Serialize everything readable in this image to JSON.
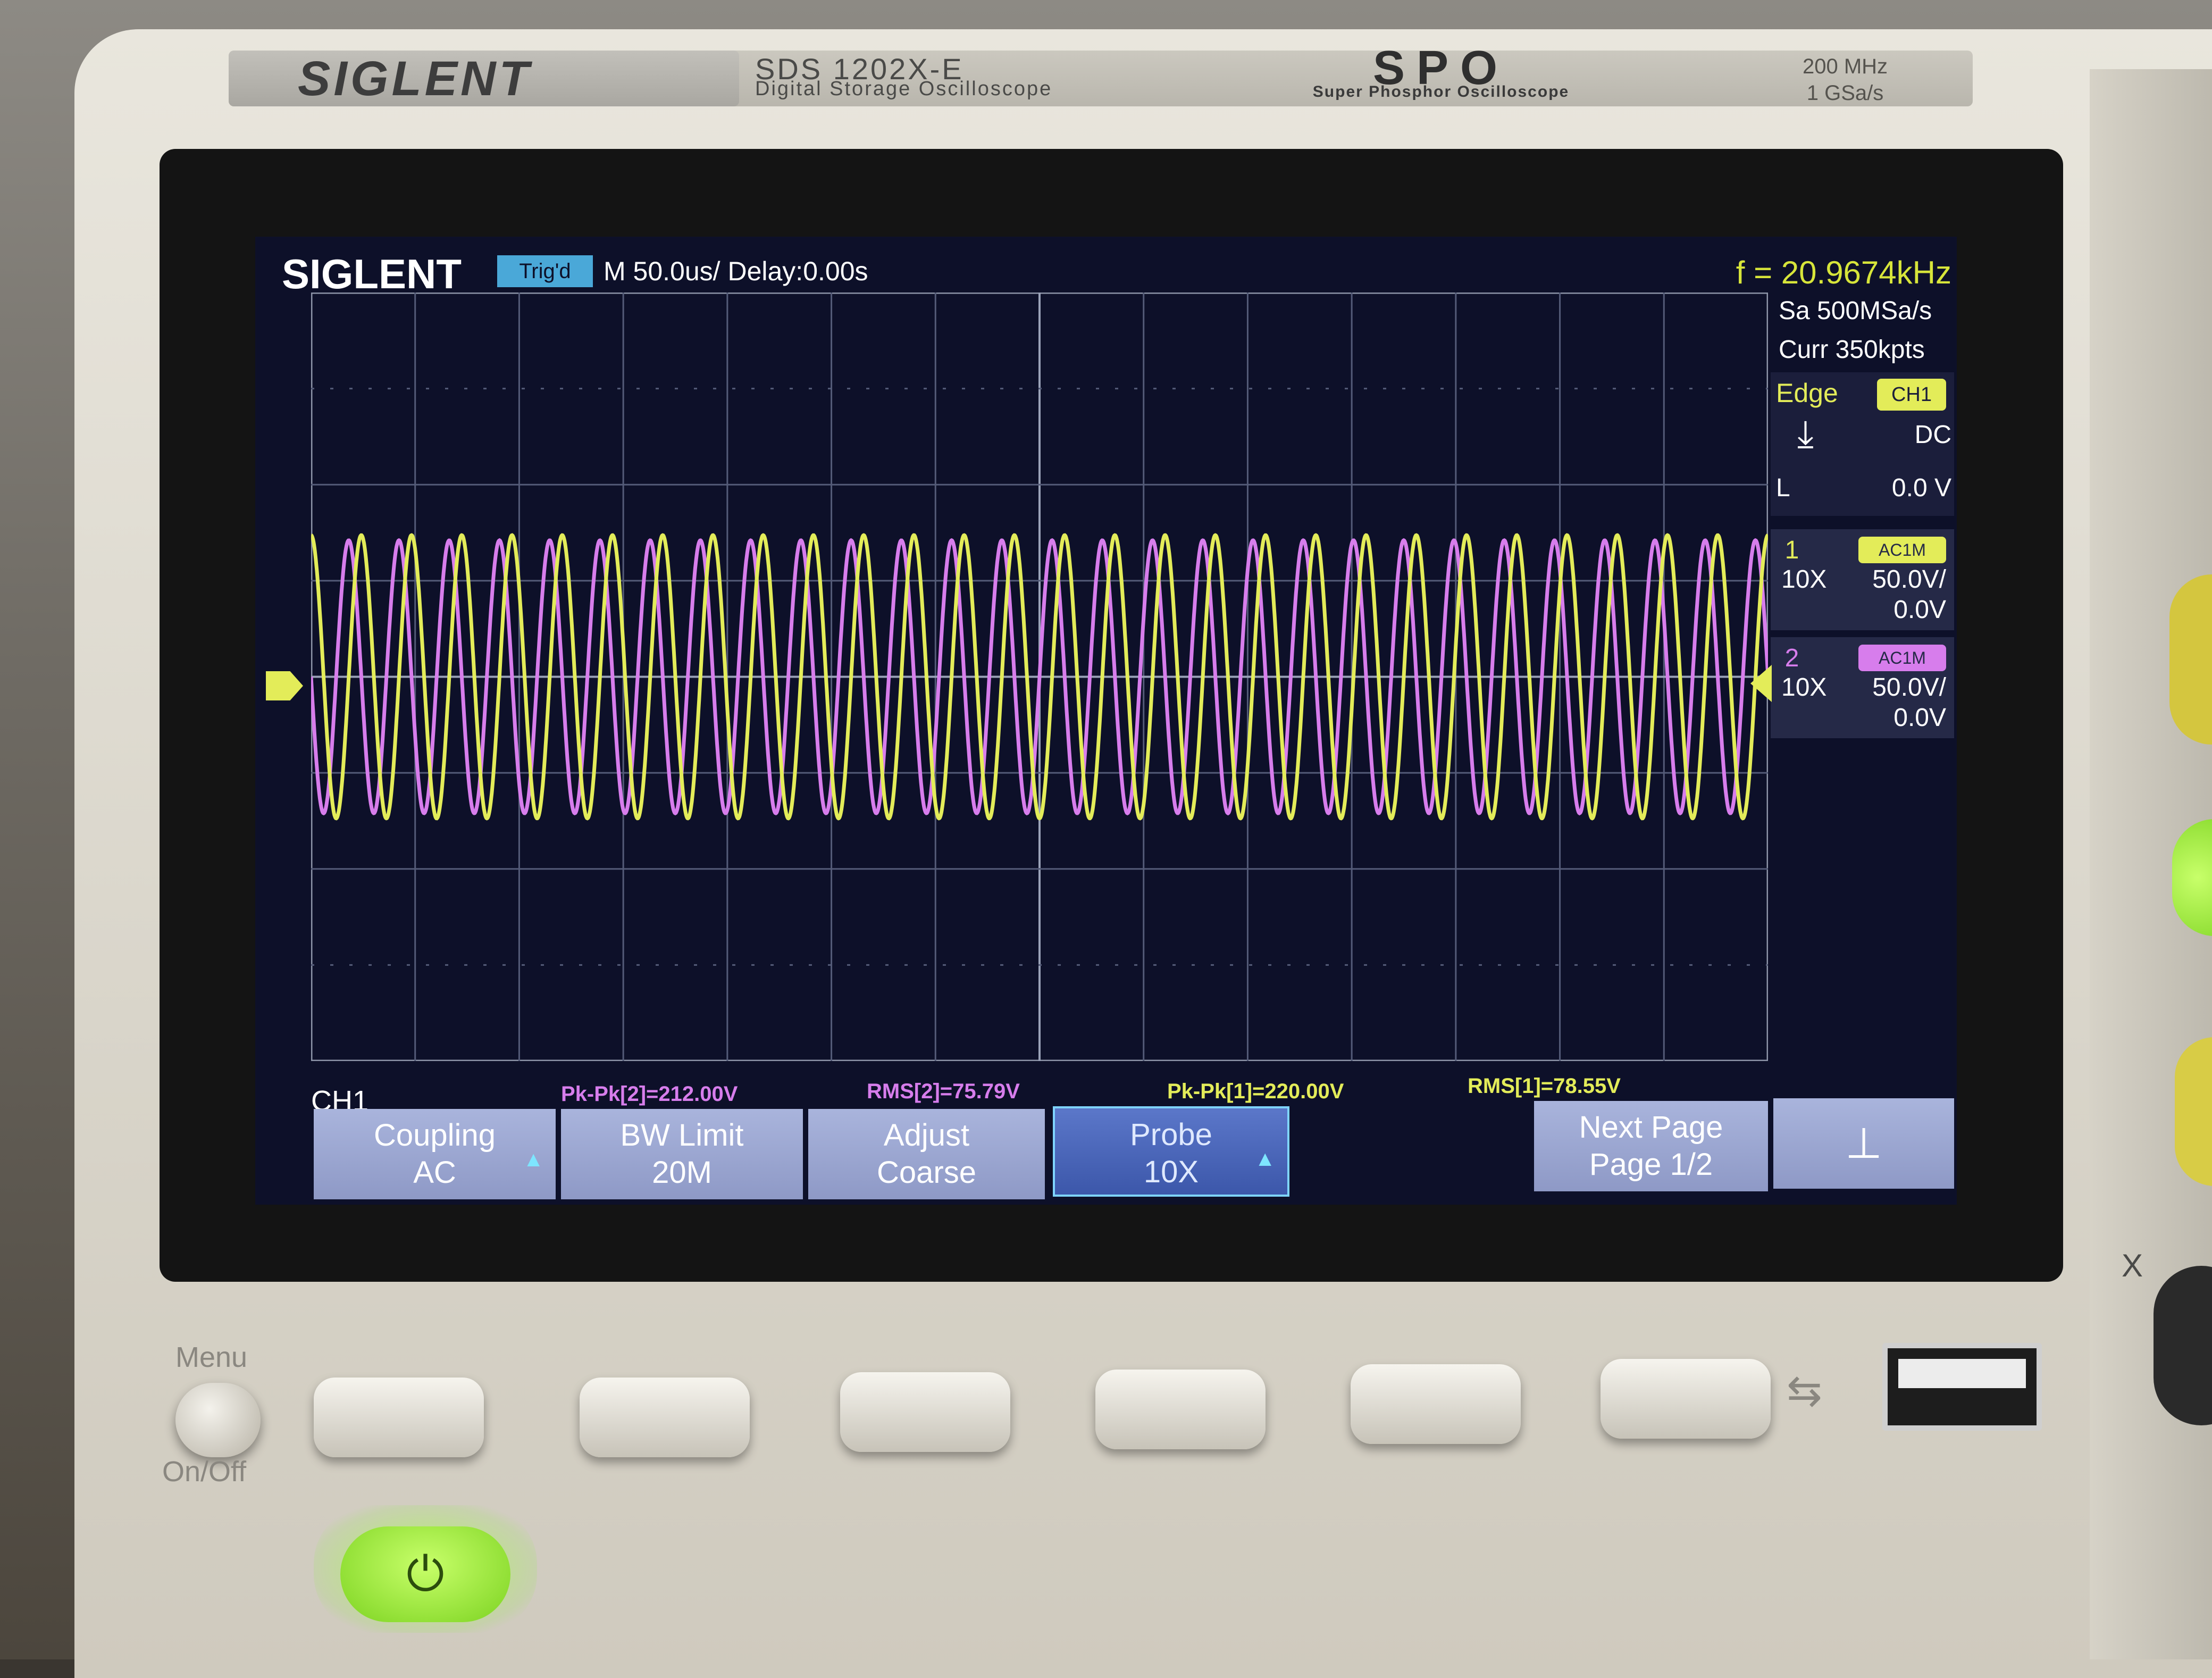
{
  "front_panel": {
    "brand": "SIGLENT",
    "model": "SDS 1202X-E",
    "model_subtitle": "Digital Storage Oscilloscope",
    "spo_logo": "SPO",
    "spo_subtitle": "Super Phosphor Oscilloscope",
    "bandwidth": "200 MHz",
    "sample_rate_spec": "1 GSa/s",
    "menu_label": "Menu",
    "onoff_label": "On/Off",
    "axis_x_label": "X"
  },
  "screen": {
    "logo": "SIGLENT",
    "trigger_status": "Trig'd",
    "timebase": "M 50.0us/",
    "delay": "Delay:0.00s",
    "frequency": "f = 20.9674kHz",
    "sample_rate": "Sa 500MSa/s",
    "memory_depth": "Curr 350kpts",
    "trigger": {
      "type": "Edge",
      "source": "CH1",
      "coupling": "DC",
      "level_label": "L",
      "level": "0.0 V"
    },
    "channels": [
      {
        "number": "1",
        "probe": "10X",
        "scale": "50.0V/",
        "offset": "0.0V",
        "badge": "AC1M",
        "color": "#e3ec59"
      },
      {
        "number": "2",
        "probe": "10X",
        "scale": "50.0V/",
        "offset": "0.0V",
        "badge": "AC1M",
        "color": "#d77dec"
      }
    ],
    "active_channel": "CH1",
    "measurements": [
      {
        "label": "Pk-Pk[2]=212.00V",
        "color": "#d77dec"
      },
      {
        "label": "RMS[2]=75.79V",
        "color": "#d77dec"
      },
      {
        "label": "Pk-Pk[1]=220.00V",
        "color": "#e3ec59"
      },
      {
        "label": "RMS[1]=78.55V",
        "color": "#e3ec59"
      }
    ],
    "softkeys": [
      {
        "line1": "Coupling",
        "line2": "AC",
        "active": false
      },
      {
        "line1": "BW Limit",
        "line2": "20M",
        "active": false
      },
      {
        "line1": "Adjust",
        "line2": "Coarse",
        "active": false
      },
      {
        "line1": "Probe",
        "line2": "10X",
        "active": true
      },
      {
        "line1": "",
        "line2": "",
        "active": false
      },
      {
        "line1": "Next Page",
        "line2": "Page 1/2",
        "active": false
      }
    ],
    "waveform": {
      "ch1_color": "#e3ec59",
      "ch2_color": "#d77dec",
      "cycles_on_screen": 29,
      "ch1_peak_divisions": 2.2,
      "ch2_peak_divisions": 2.12,
      "phase_offset_cycles": 0.5
    }
  }
}
